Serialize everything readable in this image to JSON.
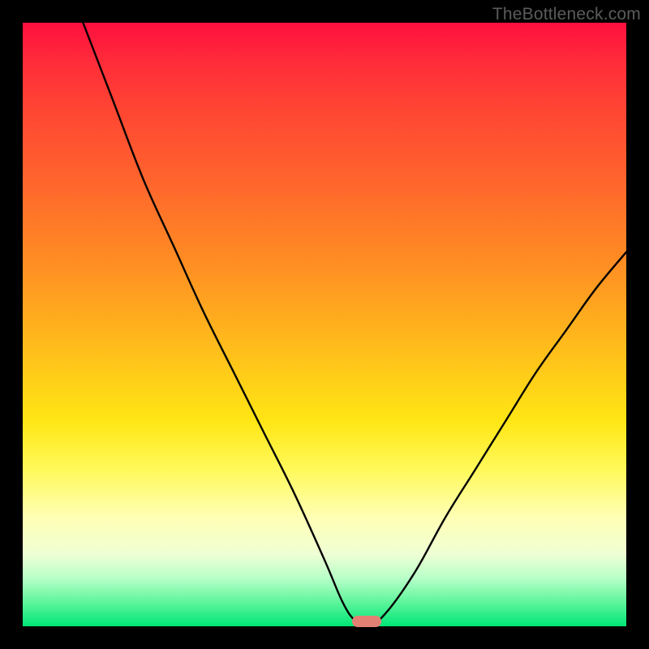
{
  "watermark": {
    "text": "TheBottleneck.com"
  },
  "chart_data": {
    "type": "line",
    "title": "",
    "xlabel": "",
    "ylabel": "",
    "xlim": [
      0,
      100
    ],
    "ylim": [
      0,
      100
    ],
    "grid": false,
    "legend": false,
    "background_gradient": {
      "direction": "vertical",
      "stops": [
        {
          "pos": 0,
          "color": "#ff0f3f"
        },
        {
          "pos": 14,
          "color": "#ff4433"
        },
        {
          "pos": 40,
          "color": "#ff8e23"
        },
        {
          "pos": 66,
          "color": "#ffe614"
        },
        {
          "pos": 82,
          "color": "#ffffb5"
        },
        {
          "pos": 96,
          "color": "#5ef59c"
        },
        {
          "pos": 100,
          "color": "#00e676"
        }
      ]
    },
    "series": [
      {
        "name": "bottleneck-curve",
        "color": "#000000",
        "x": [
          10,
          15,
          20,
          25,
          30,
          35,
          40,
          45,
          50,
          53,
          55,
          57,
          60,
          65,
          70,
          75,
          80,
          85,
          90,
          95,
          100
        ],
        "y": [
          100,
          87,
          74,
          63,
          52,
          42,
          32,
          22,
          11,
          4,
          1,
          0,
          2,
          9,
          18,
          26,
          34,
          42,
          49,
          56,
          62
        ]
      }
    ],
    "marker": {
      "name": "optimal-point",
      "x": 57,
      "y": 0,
      "shape": "pill",
      "color": "#e38074"
    }
  }
}
